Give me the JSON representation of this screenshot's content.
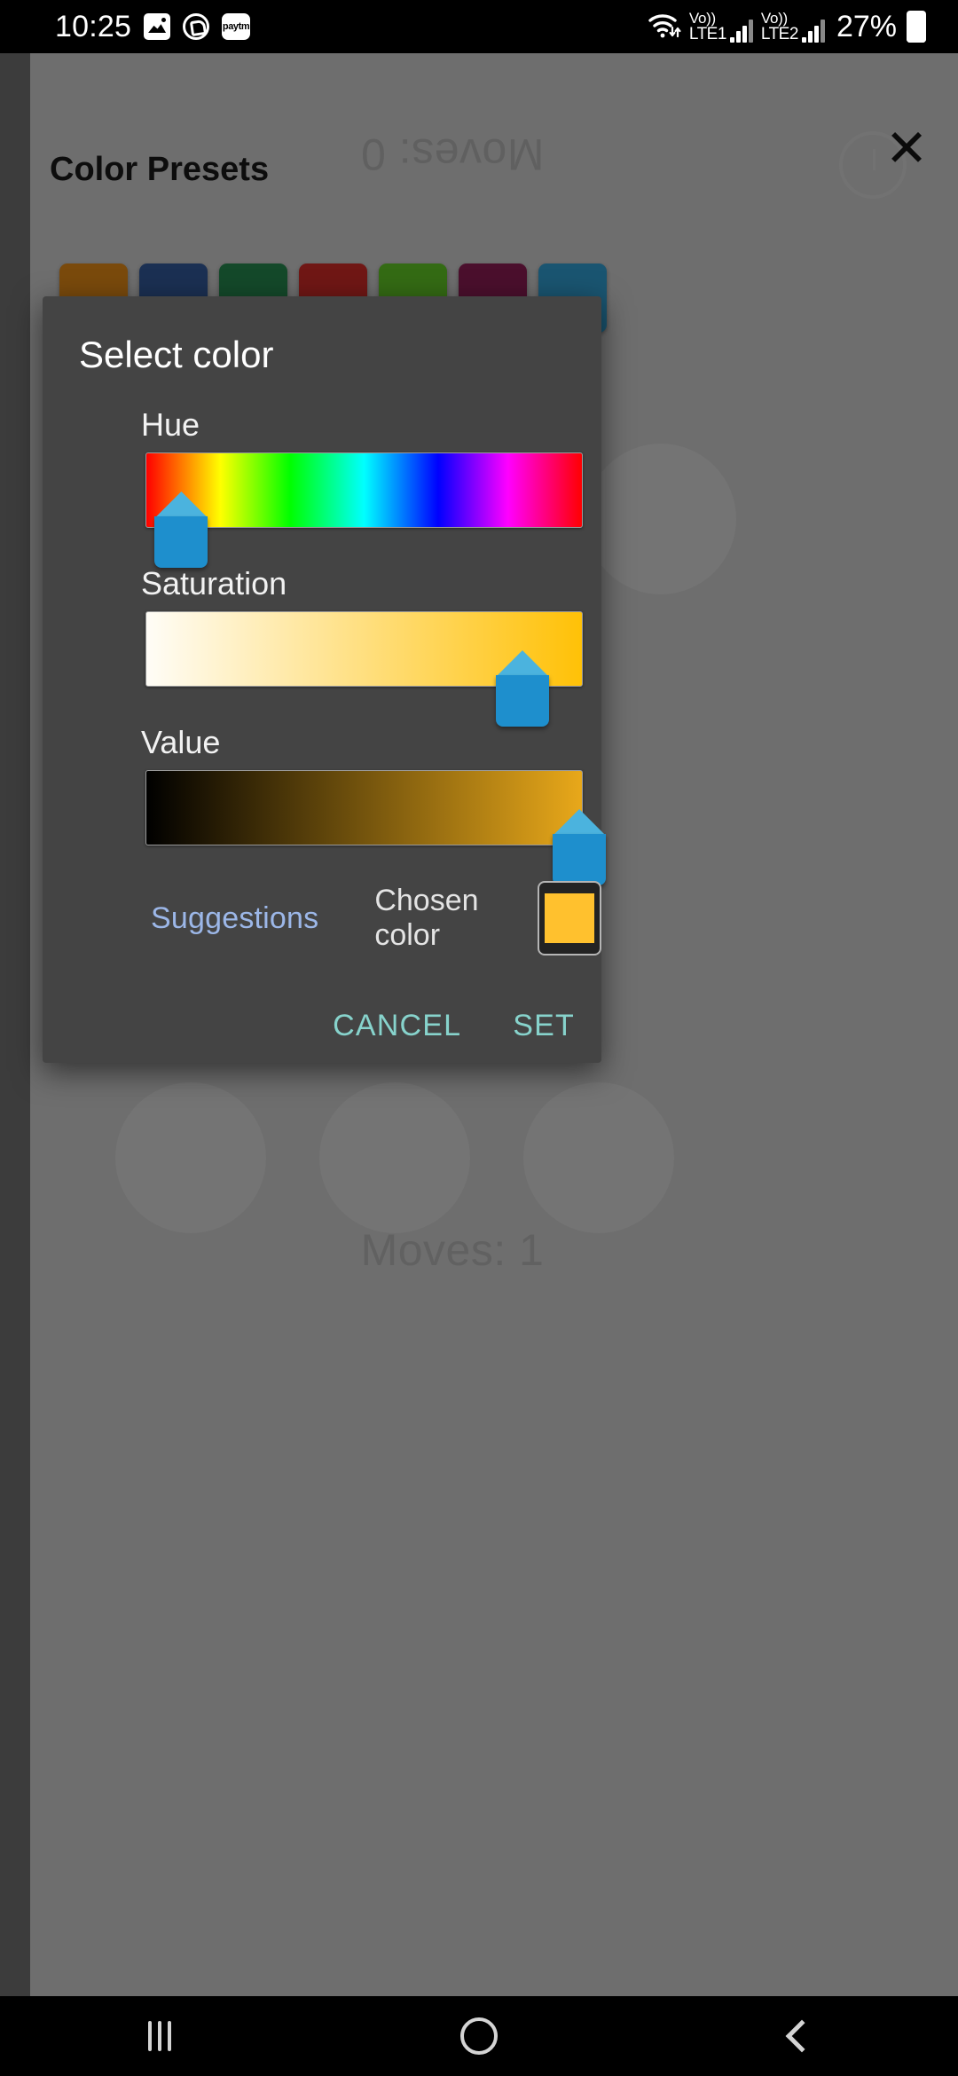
{
  "status_bar": {
    "time": "10:25",
    "app_icons": [
      {
        "name": "photos-icon",
        "label": ""
      },
      {
        "name": "whatsapp-icon",
        "label": ""
      },
      {
        "name": "paytm-icon",
        "label": "paytm"
      }
    ],
    "wifi_icon": "wifi-icon",
    "sim1": {
      "volte": "Vo))",
      "network": "LTE1"
    },
    "sim2": {
      "volte": "Vo))",
      "network": "LTE2"
    },
    "battery_percent": "27%"
  },
  "background_app": {
    "title": "Color Presets",
    "close_label": "✕",
    "moves_top": "Moves: 0",
    "moves_bottom": "Moves: 1",
    "preset_rows": [
      [
        {
          "name": "preset-brown",
          "color": "#7a4a0c"
        },
        {
          "name": "preset-navy",
          "color": "#1b3053"
        },
        {
          "name": "preset-forest",
          "color": "#14492a"
        },
        {
          "name": "preset-darkred",
          "color": "#701715"
        },
        {
          "name": "preset-olivegreen",
          "color": "#346b14"
        },
        {
          "name": "preset-maroon",
          "color": "#4b0f2d"
        },
        {
          "name": "preset-teal",
          "color": "#1a5571"
        }
      ],
      [
        {
          "name": "preset-empty-1",
          "color": "transparent"
        },
        {
          "name": "preset-charcoal",
          "color": "#2f2f2f"
        },
        {
          "name": "preset-empty-2",
          "color": "transparent"
        },
        {
          "name": "preset-wine",
          "color": "#5c0530"
        },
        {
          "name": "preset-empty-3",
          "color": "transparent"
        },
        {
          "name": "preset-black",
          "color": "#0a0a0a"
        },
        {
          "name": "preset-empty-4",
          "color": "transparent"
        }
      ]
    ]
  },
  "dialog": {
    "title": "Select color",
    "sliders": [
      {
        "name": "hue",
        "label": "Hue",
        "value_pct": 8
      },
      {
        "name": "saturation",
        "label": "Saturation",
        "value_pct": 86
      },
      {
        "name": "value",
        "label": "Value",
        "value_pct": 99
      }
    ],
    "suggestions_label": "Suggestions",
    "chosen_color_label": "Chosen color",
    "chosen_color": "#FFC12E",
    "cancel_label": "CANCEL",
    "set_label": "SET",
    "accent_color": "#87d3cc",
    "link_color": "#9cb7e8",
    "thumb_color": "#1e8fcd"
  },
  "nav_bar": {
    "recents": "recents-icon",
    "home": "home-icon",
    "back": "back-icon"
  }
}
